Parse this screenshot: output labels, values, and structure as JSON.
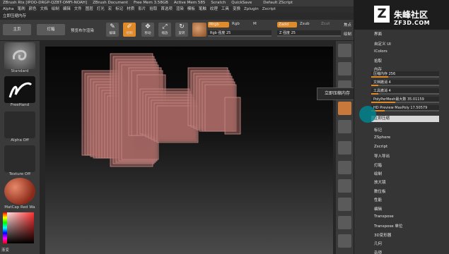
{
  "titlebar": {
    "items": [
      "ZBrush Rtx  [IPOO-DRGP-QZBT-OMFI-NOAH]",
      "ZBrush Document",
      "Free Mem 3.58GB",
      "Active Mem 585",
      "Scratch",
      "QuickSave",
      "",
      "Default ZScript"
    ]
  },
  "menubar": {
    "items": [
      "Alpha",
      "笔刷",
      "颜色",
      "文档",
      "绘制",
      "编辑",
      "文件",
      "图层",
      "灯光",
      "宏",
      "标记",
      "材质",
      "影片",
      "拾取",
      "首选项",
      "渲染",
      "模板",
      "笔触",
      "纹理",
      "工具",
      "变换",
      "Zplugin",
      "Zscript"
    ]
  },
  "subbar": {
    "label": "立即压缩内存"
  },
  "toolbar": {
    "home": "主页",
    "lightbox": "灯箱",
    "preview": "预览布尔渲染",
    "edit": "编辑",
    "draw": "绘制",
    "move": "移动",
    "scale": "缩放",
    "rotate": "旋转",
    "mrgb": "Mrgb",
    "rgb": "Rgb",
    "m": "M",
    "rgb_intensity": "Rgb 强度 25",
    "zadd": "Zadd",
    "zsub": "Zsub",
    "zcut": "Zcut",
    "z_intensity": "Z 强度 25",
    "focal": "焦点",
    "draw_size": "绘制"
  },
  "leftpanel": {
    "standard": "Standard",
    "freehand": "FreeHand",
    "alpha_off": "Alpha Off",
    "texture_off": "Texture Off",
    "matcap": "MatCap Red Wa",
    "gradient": "渐变"
  },
  "rtools": {
    "spix": "SPix",
    "zoom": "滚动",
    "actual": "实际",
    "aahalf": "AAHalf",
    "persp": "透视",
    "floor": "地面",
    "frame": "框架",
    "move": "移动",
    "scale": "缩放",
    "rotate": "旋转"
  },
  "tooltip": "立即压缩内存",
  "watermark": {
    "logo": "Z",
    "title": "朱峰社区",
    "url": "ZF3D.COM"
  },
  "rpanel": {
    "items_top": [
      "权限",
      "界面",
      "自定义 UI",
      "lColors",
      "拾取",
      "内存"
    ],
    "sliders": [
      {
        "label": "压缩内存 256",
        "fill": 0.25
      },
      {
        "label": "文档撤消 4",
        "fill": 0.1
      },
      {
        "label": "工具撤消 4",
        "fill": 0.1
      },
      {
        "label": "PolyPerMesh最大数 35.01159",
        "fill": 0.35
      },
      {
        "label": "HD Preview MaxPoly 17.50579",
        "fill": 0.2
      }
    ],
    "compact_button": "立即压缩",
    "items_bottom": [
      "标记",
      "ZSphere",
      "Zscript",
      "导入导出",
      "灯箱",
      "绘制",
      "放大镜",
      "数位板",
      "性能",
      "编辑",
      "Transpose",
      "Transpose 单位",
      "3D变形器",
      "几何",
      "杂项"
    ]
  }
}
